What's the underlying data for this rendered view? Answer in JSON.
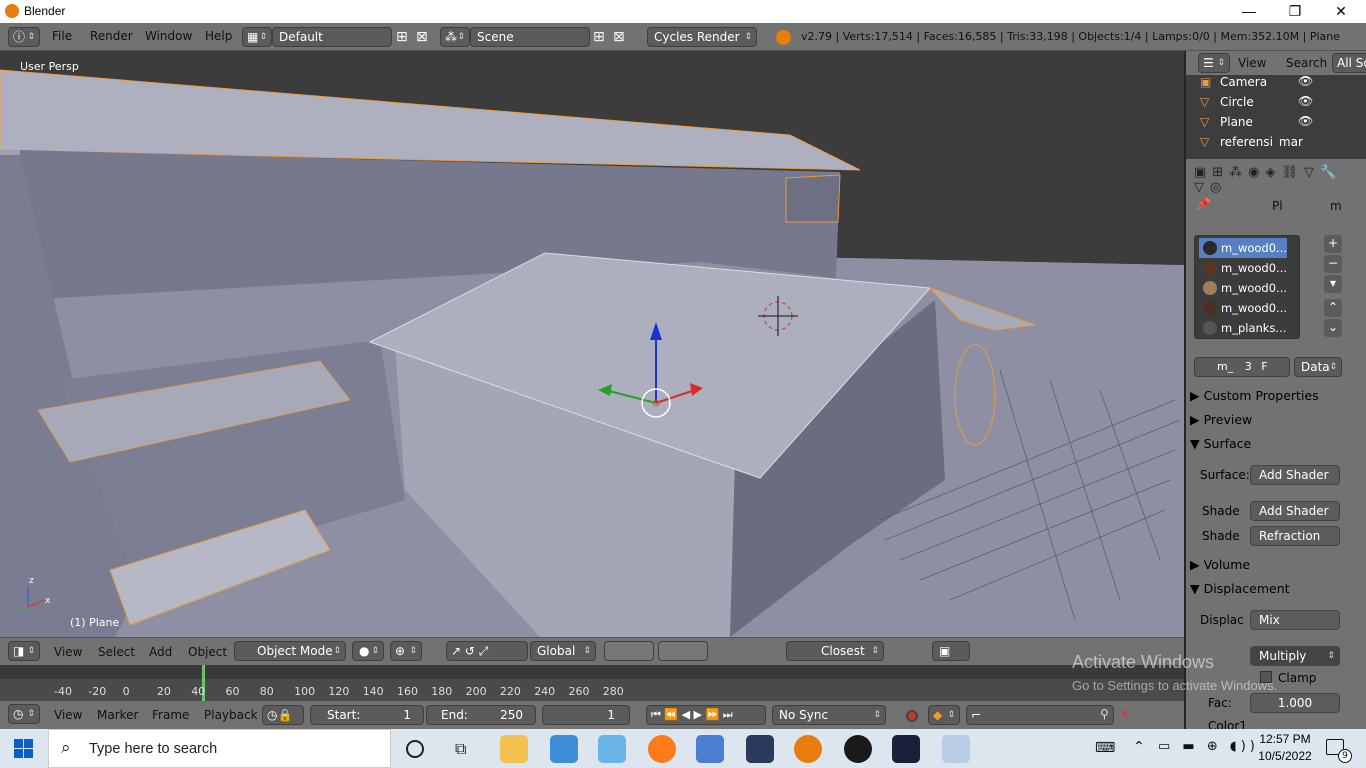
{
  "window": {
    "title": "Blender",
    "minimize": "—",
    "maximize": "❐",
    "close": "✕"
  },
  "menu": {
    "file": "File",
    "render": "Render",
    "window": "Window",
    "help": "Help"
  },
  "layout": {
    "screen": "Default",
    "scene": "Scene",
    "engine": "Cycles Render"
  },
  "stats": "v2.79 | Verts:17,514 | Faces:16,585 | Tris:33,198 | Objects:1/4 | Lamps:0/0 | Mem:352.10M | Plane",
  "viewport": {
    "label": "User Persp",
    "object_label": "(1) Plane"
  },
  "vp_header": {
    "view": "View",
    "select": "Select",
    "add": "Add",
    "object": "Object",
    "mode": "Object Mode",
    "orientation": "Global",
    "snap": "Closest"
  },
  "timeline": {
    "ticks": [
      "-40",
      "-20",
      "0",
      "20",
      "40",
      "60",
      "80",
      "100",
      "120",
      "140",
      "160",
      "180",
      "200",
      "220",
      "240",
      "260",
      "280"
    ],
    "view": "View",
    "marker": "Marker",
    "frame": "Frame",
    "playback": "Playback",
    "start_label": "Start:",
    "start": "1",
    "end_label": "End:",
    "end": "250",
    "current": "1",
    "sync": "No Sync"
  },
  "outliner": {
    "view": "View",
    "search": "Search",
    "all": "All Sc",
    "items": [
      {
        "name": "Camera"
      },
      {
        "name": "Circle"
      },
      {
        "name": "Plane"
      },
      {
        "name": "referensi_mar"
      }
    ]
  },
  "properties": {
    "breadcrumb_obj": "Pl",
    "breadcrumb_mat": "m",
    "materials": [
      {
        "name": "m_wood0...",
        "color": "#2a2a2a"
      },
      {
        "name": "m_wood0...",
        "color": "#5a3620"
      },
      {
        "name": "m_wood0...",
        "color": "#a0805c"
      },
      {
        "name": "m_wood0...",
        "color": "#4a3020"
      },
      {
        "name": "m_planks...",
        "color": "#555555"
      }
    ],
    "mat_field": "m_",
    "mat_users": "3",
    "mat_fake": "F",
    "data_select": "Data",
    "custom_properties": "Custom Properties",
    "preview": "Preview",
    "surface": "Surface",
    "surface_label": "Surface:",
    "surface_value": "Add Shader",
    "shade1_label": "Shade",
    "shade1_value": "Add Shader",
    "shade2_label": "Shade",
    "shade2_value": "Refraction BSDF",
    "volume": "Volume",
    "displacement": "Displacement",
    "displac_label": "Displac",
    "displac_value": "Mix",
    "blend_value": "Multiply",
    "clamp": "Clamp",
    "fac_label": "Fac:",
    "fac_value": "1.000",
    "color1": "Color1"
  },
  "watermark": {
    "line1": "Activate Windows",
    "line2": "Go to Settings to activate Windows."
  },
  "taskbar": {
    "search_placeholder": "Type here to search",
    "time": "12:57 PM",
    "date": "10/5/2022",
    "notifications": "9"
  }
}
